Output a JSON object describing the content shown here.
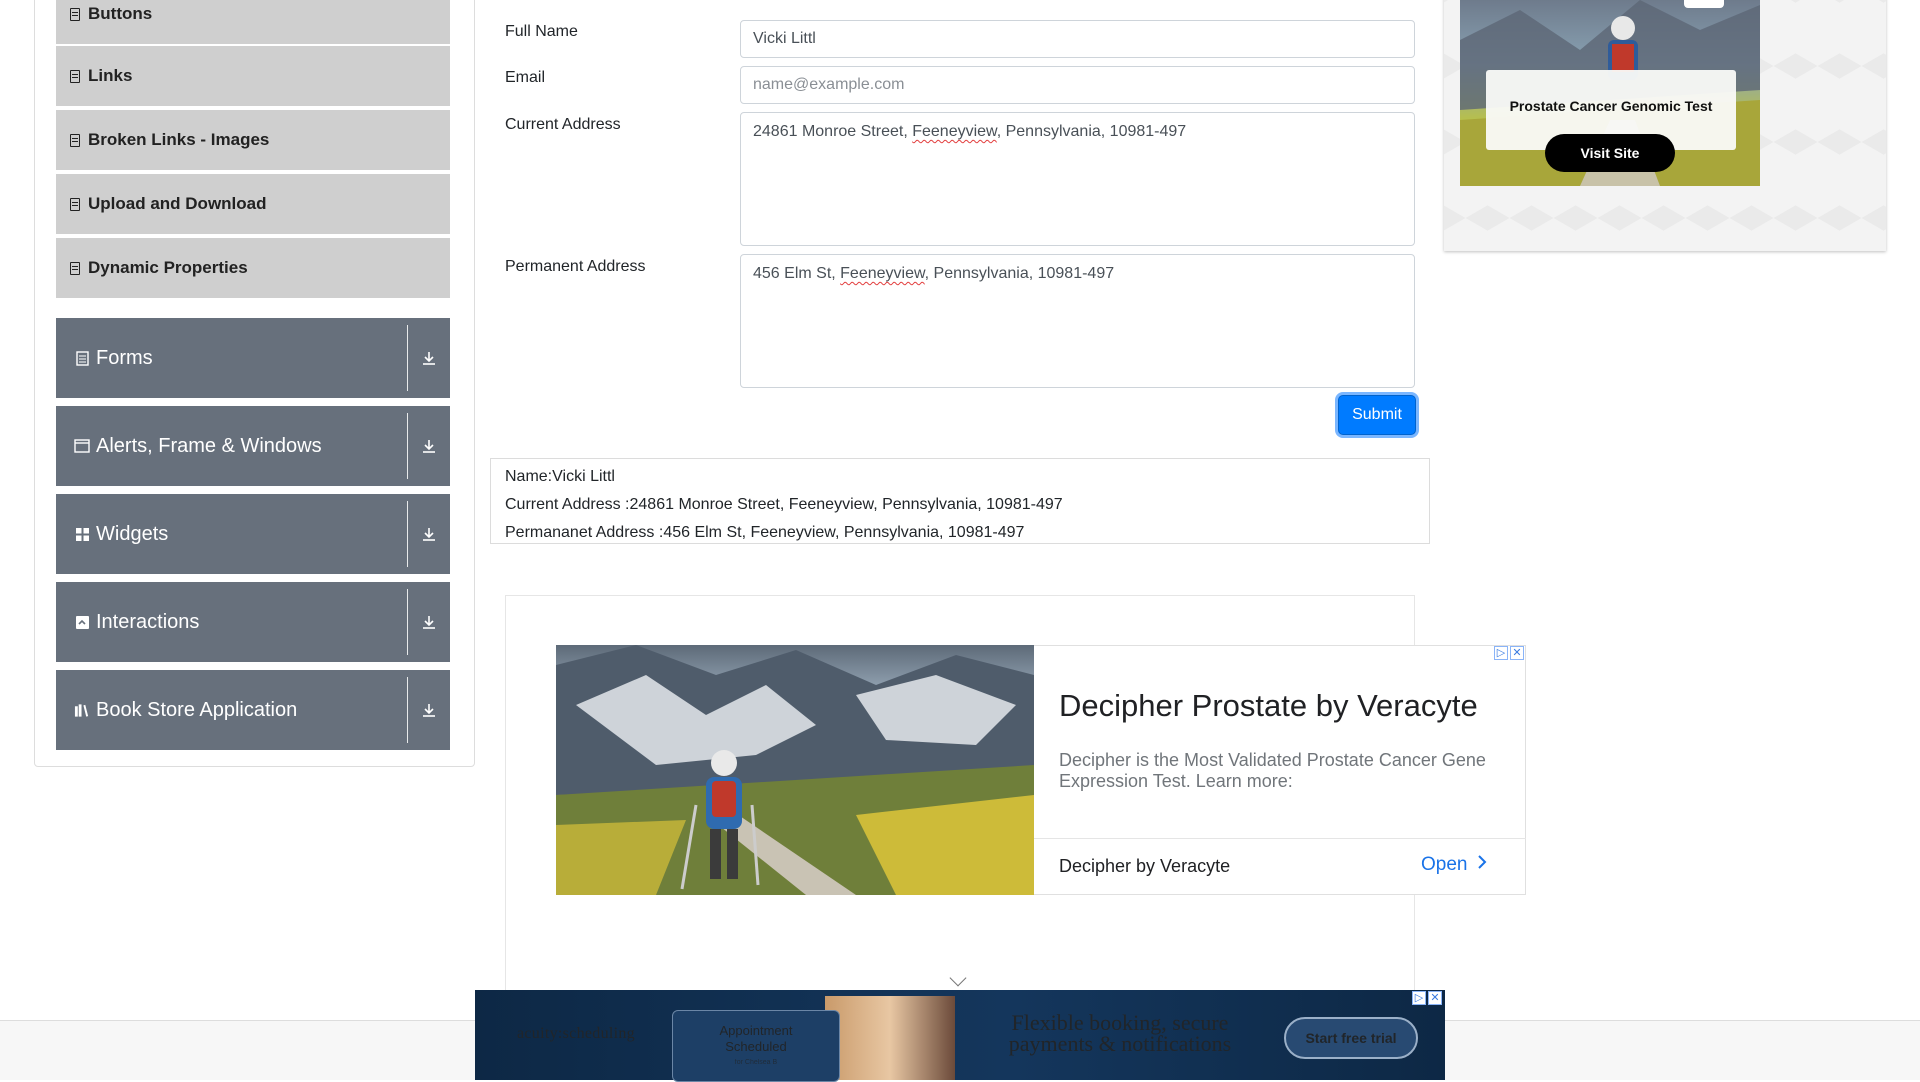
{
  "sidebar": {
    "sub_items": [
      {
        "label": "Buttons"
      },
      {
        "label": "Links"
      },
      {
        "label": "Broken Links - Images"
      },
      {
        "label": "Upload and Download"
      },
      {
        "label": "Dynamic Properties"
      }
    ],
    "groups": [
      {
        "label": "Forms",
        "icon": "form-icon"
      },
      {
        "label": "Alerts, Frame & Windows",
        "icon": "window-icon"
      },
      {
        "label": "Widgets",
        "icon": "widgets-icon"
      },
      {
        "label": "Interactions",
        "icon": "interactions-icon"
      },
      {
        "label": "Book Store Application",
        "icon": "books-icon"
      }
    ]
  },
  "form": {
    "full_name_label": "Full Name",
    "full_name_value": "Vicki Littl",
    "email_label": "Email",
    "email_placeholder": "name@example.com",
    "current_address_label": "Current Address",
    "current_address_value_a": "24861 Monroe Street, ",
    "current_address_value_b": "Feeneyview",
    "current_address_value_c": ", Pennsylvania, 10981-497",
    "permanent_address_label": "Permanent Address",
    "permanent_address_value_a": "456 Elm St, ",
    "permanent_address_value_b": "Feeneyview",
    "permanent_address_value_c": ", Pennsylvania, 10981-497",
    "submit_label": "Submit"
  },
  "output": {
    "name": "Name:Vicki Littl",
    "current_address": "Current Address :24861 Monroe Street, Feeneyview, Pennsylvania, 10981-497",
    "permanent_address": "Permananet Address :456 Elm St, Feeneyview, Pennsylvania, 10981-497"
  },
  "right_ad": {
    "title": "Prostate Cancer Genomic Test",
    "button": "Visit Site"
  },
  "middle_ad": {
    "title": "Decipher Prostate by Veracyte",
    "description": "Decipher is the Most Validated Prostate Cancer Gene Expression Test. Learn more:",
    "brand": "Decipher by Veracyte",
    "cta": "Open"
  },
  "bottom_ad": {
    "logo": "acuity:scheduling",
    "card_line1": "Appointment",
    "card_line2": "Scheduled",
    "card_line3": "for Chelsea B",
    "headline": "Flexible booking, secure payments & notifications",
    "cta": "Start free trial"
  },
  "colors": {
    "primary": "#007bff",
    "sidebar_group": "#67707c",
    "sidebar_sub": "#cfcfcf",
    "ad_link": "#1a73e8"
  }
}
